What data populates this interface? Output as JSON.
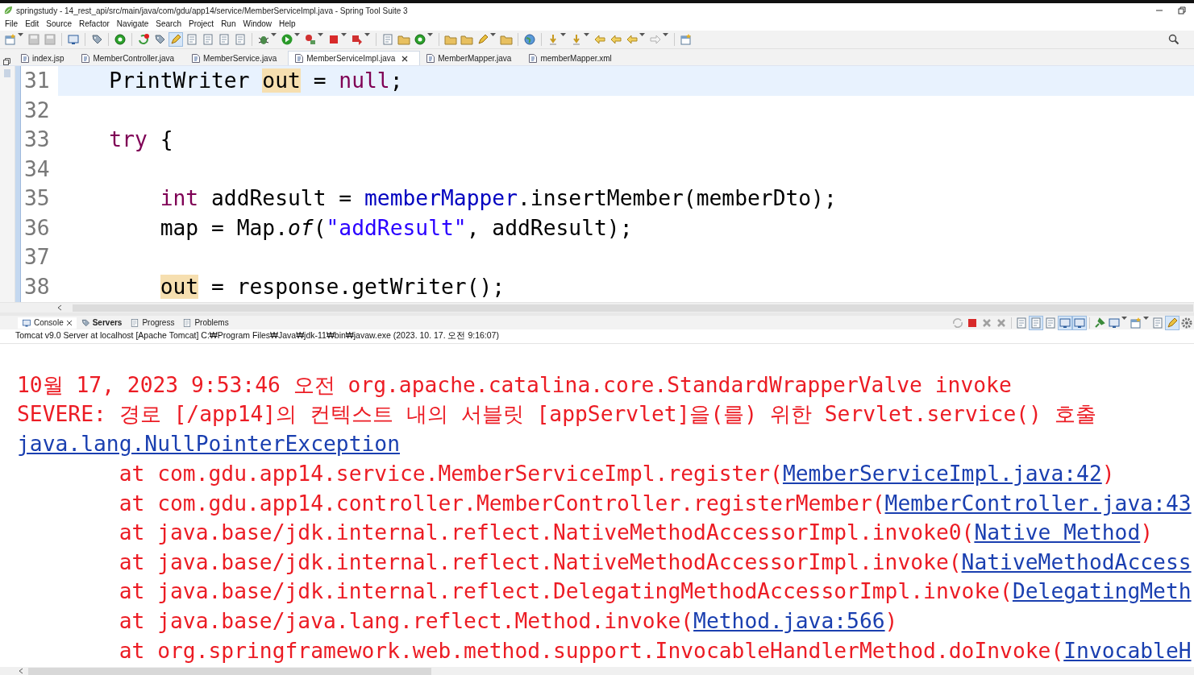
{
  "window": {
    "title": "springstudy - 14_rest_api/src/main/java/com/gdu/app14/service/MemberServiceImpl.java - Spring Tool Suite 3"
  },
  "menu": [
    "File",
    "Edit",
    "Source",
    "Refactor",
    "Navigate",
    "Search",
    "Project",
    "Run",
    "Window",
    "Help"
  ],
  "toolbar": [
    {
      "kind": "button",
      "pressed": false,
      "dropdown": true
    },
    {
      "kind": "button",
      "pressed": false,
      "dropdown": false
    },
    {
      "kind": "button",
      "pressed": false,
      "dropdown": false
    },
    {
      "kind": "separator"
    },
    {
      "kind": "button",
      "pressed": false,
      "dropdown": false
    },
    {
      "kind": "separator"
    },
    {
      "kind": "button",
      "pressed": false,
      "dropdown": false
    },
    {
      "kind": "separator"
    },
    {
      "kind": "button",
      "pressed": false,
      "dropdown": false
    },
    {
      "kind": "separator"
    },
    {
      "kind": "button",
      "pressed": false,
      "dropdown": false
    },
    {
      "kind": "button",
      "pressed": false,
      "dropdown": false
    },
    {
      "kind": "button",
      "pressed": true,
      "dropdown": false
    },
    {
      "kind": "button",
      "pressed": false,
      "dropdown": false
    },
    {
      "kind": "button",
      "pressed": false,
      "dropdown": false
    },
    {
      "kind": "button",
      "pressed": false,
      "dropdown": false
    },
    {
      "kind": "button",
      "pressed": false,
      "dropdown": false
    },
    {
      "kind": "separator"
    },
    {
      "kind": "button",
      "pressed": false,
      "dropdown": true
    },
    {
      "kind": "button",
      "pressed": false,
      "dropdown": true
    },
    {
      "kind": "button",
      "pressed": false,
      "dropdown": true
    },
    {
      "kind": "button",
      "pressed": false,
      "dropdown": true
    },
    {
      "kind": "button",
      "pressed": false,
      "dropdown": true
    },
    {
      "kind": "separator"
    },
    {
      "kind": "button",
      "pressed": false,
      "dropdown": false
    },
    {
      "kind": "button",
      "pressed": false,
      "dropdown": false
    },
    {
      "kind": "button",
      "pressed": false,
      "dropdown": true
    },
    {
      "kind": "separator"
    },
    {
      "kind": "button",
      "pressed": false,
      "dropdown": false
    },
    {
      "kind": "button",
      "pressed": false,
      "dropdown": false
    },
    {
      "kind": "button",
      "pressed": false,
      "dropdown": true
    },
    {
      "kind": "button",
      "pressed": false,
      "dropdown": false
    },
    {
      "kind": "separator"
    },
    {
      "kind": "button",
      "pressed": false,
      "dropdown": false
    },
    {
      "kind": "separator"
    },
    {
      "kind": "button",
      "pressed": false,
      "dropdown": true
    },
    {
      "kind": "button",
      "pressed": false,
      "dropdown": true
    },
    {
      "kind": "button",
      "pressed": false,
      "dropdown": false
    },
    {
      "kind": "button",
      "pressed": false,
      "dropdown": false
    },
    {
      "kind": "button",
      "pressed": false,
      "dropdown": true
    },
    {
      "kind": "button",
      "pressed": false,
      "dropdown": true
    },
    {
      "kind": "separator"
    },
    {
      "kind": "button",
      "pressed": false,
      "dropdown": false
    }
  ],
  "editor_tabs": [
    {
      "label": "index.jsp",
      "selected": false
    },
    {
      "label": "MemberController.java",
      "selected": false
    },
    {
      "label": "MemberService.java",
      "selected": false
    },
    {
      "label": "MemberServiceImpl.java",
      "selected": true
    },
    {
      "label": "MemberMapper.java",
      "selected": false
    },
    {
      "label": "memberMapper.xml",
      "selected": false
    }
  ],
  "code_lines": [
    {
      "number": "31",
      "current": true,
      "tokens": [
        {
          "text": "PrintWriter ",
          "kind": "plain"
        },
        {
          "text": "out",
          "kind": "occurrence"
        },
        {
          "text": " = ",
          "kind": "plain"
        },
        {
          "text": "null",
          "kind": "keyword"
        },
        {
          "text": ";",
          "kind": "plain"
        }
      ]
    },
    {
      "number": "32",
      "current": false
    },
    {
      "number": "33",
      "current": false,
      "tokens": [
        {
          "text": "try",
          "kind": "keyword"
        },
        {
          "text": " {",
          "kind": "plain"
        }
      ],
      "children": [
        {
          "number": "34",
          "current": false
        },
        {
          "number": "35",
          "current": false,
          "tokens": [
            {
              "text": "int",
              "kind": "keyword"
            },
            {
              "text": " addResult = ",
              "kind": "plain"
            },
            {
              "text": "memberMapper",
              "kind": "field"
            },
            {
              "text": ".insertMember(memberDto);",
              "kind": "plain"
            }
          ]
        },
        {
          "number": "36",
          "current": false,
          "tokens": [
            {
              "text": "map = Map.",
              "kind": "plain"
            },
            {
              "text": "of",
              "kind": "static"
            },
            {
              "text": "(",
              "kind": "plain"
            },
            {
              "text": "\"addResult\"",
              "kind": "string"
            },
            {
              "text": ", addResult);",
              "kind": "plain"
            }
          ]
        },
        {
          "number": "37",
          "current": false
        },
        {
          "number": "38",
          "current": false,
          "tokens": [
            {
              "text": "out",
              "kind": "occurrence"
            },
            {
              "text": " = response.getWriter();",
              "kind": "plain"
            }
          ]
        }
      ]
    }
  ],
  "console_tabs": [
    {
      "label": "Console",
      "selected": true,
      "closable": true
    },
    {
      "label": "Servers",
      "selected": false,
      "closable": false
    },
    {
      "label": "Progress",
      "selected": false,
      "closable": false
    },
    {
      "label": "Problems",
      "selected": false,
      "closable": false
    }
  ],
  "console_toolbar": [
    {
      "kind": "button",
      "pressed": false,
      "dropdown": false
    },
    {
      "kind": "button",
      "pressed": false,
      "dropdown": false
    },
    {
      "kind": "button",
      "pressed": false,
      "dropdown": false
    },
    {
      "kind": "button",
      "pressed": false,
      "dropdown": false
    },
    {
      "kind": "separator"
    },
    {
      "kind": "button",
      "pressed": false,
      "dropdown": false
    },
    {
      "kind": "button",
      "pressed": true,
      "dropdown": false
    },
    {
      "kind": "button",
      "pressed": false,
      "dropdown": false
    },
    {
      "kind": "button",
      "pressed": true,
      "dropdown": false
    },
    {
      "kind": "button",
      "pressed": true,
      "dropdown": false
    },
    {
      "kind": "separator"
    },
    {
      "kind": "button",
      "pressed": false,
      "dropdown": false
    },
    {
      "kind": "button",
      "pressed": false,
      "dropdown": true
    },
    {
      "kind": "button",
      "pressed": false,
      "dropdown": true
    },
    {
      "kind": "button",
      "pressed": false,
      "dropdown": false
    },
    {
      "kind": "button",
      "pressed": true,
      "dropdown": false
    },
    {
      "kind": "button",
      "pressed": false,
      "dropdown": false
    }
  ],
  "console_process": "Tomcat v9.0 Server at localhost [Apache Tomcat] C:₩Program Files₩Java₩jdk-11₩bin₩javaw.exe  (2023. 10. 17. 오전 9:16:07)",
  "console_lines": [
    {
      "segments": [
        {
          "text": "10월 17, 2023 9:53:46 오전 org.apache.catalina.core.StandardWrapperValve invoke",
          "kind": "text"
        }
      ]
    },
    {
      "segments": [
        {
          "text": "SEVERE: 경로 [/app14]의 컨텍스트 내의 서블릿 [appServlet]을(를) 위한 Servlet.service() 호출",
          "kind": "text"
        }
      ]
    },
    {
      "segments": [
        {
          "text": "java.lang.NullPointerException",
          "kind": "link"
        }
      ],
      "children": [
        {
          "segments": [
            {
              "text": "at com.gdu.app14.service.MemberServiceImpl.register(",
              "kind": "text"
            },
            {
              "text": "MemberServiceImpl.java:42",
              "kind": "link"
            },
            {
              "text": ")",
              "kind": "text"
            }
          ]
        },
        {
          "segments": [
            {
              "text": "at com.gdu.app14.controller.MemberController.registerMember(",
              "kind": "text"
            },
            {
              "text": "MemberController.java:43",
              "kind": "link"
            }
          ]
        },
        {
          "segments": [
            {
              "text": "at java.base/jdk.internal.reflect.NativeMethodAccessorImpl.invoke0(",
              "kind": "text"
            },
            {
              "text": "Native Method",
              "kind": "link"
            },
            {
              "text": ")",
              "kind": "text"
            }
          ]
        },
        {
          "segments": [
            {
              "text": "at java.base/jdk.internal.reflect.NativeMethodAccessorImpl.invoke(",
              "kind": "text"
            },
            {
              "text": "NativeMethodAccess",
              "kind": "link"
            }
          ]
        },
        {
          "segments": [
            {
              "text": "at java.base/jdk.internal.reflect.DelegatingMethodAccessorImpl.invoke(",
              "kind": "text"
            },
            {
              "text": "DelegatingMeth",
              "kind": "link"
            }
          ]
        },
        {
          "segments": [
            {
              "text": "at java.base/java.lang.reflect.Method.invoke(",
              "kind": "text"
            },
            {
              "text": "Method.java:566",
              "kind": "link"
            },
            {
              "text": ")",
              "kind": "text"
            }
          ]
        },
        {
          "segments": [
            {
              "text": "at org.springframework.web.method.support.InvocableHandlerMethod.doInvoke(",
              "kind": "text"
            },
            {
              "text": "InvocableH",
              "kind": "link"
            }
          ]
        }
      ]
    }
  ]
}
